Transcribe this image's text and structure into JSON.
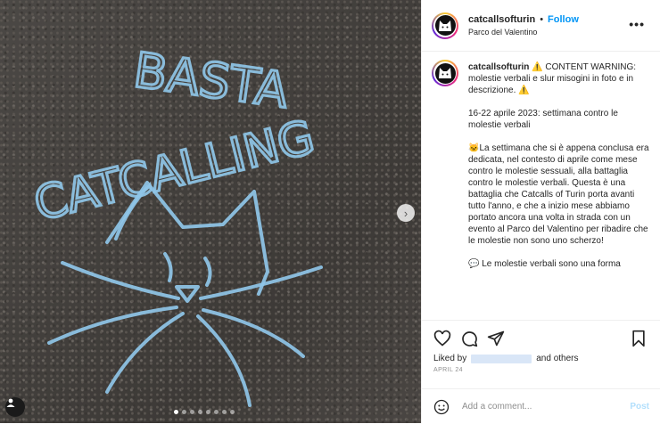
{
  "photo": {
    "chalk_line1": "BASTA",
    "chalk_line2": "CATCALLING",
    "carousel_dots": 8,
    "active_dot": 0
  },
  "header": {
    "username": "catcallsofturin",
    "separator": "•",
    "follow_label": "Follow",
    "location": "Parco del Valentino",
    "more_label": "•••"
  },
  "caption": {
    "username": "catcallsofturin",
    "paragraphs": [
      "⚠️ CONTENT WARNING: molestie verbali e slur misogini in foto e in descrizione. ⚠️",
      "16-22 aprile 2023: settimana contro le molestie verbali",
      "🐱La settimana che si è appena conclusa era dedicata, nel contesto di aprile come mese contro le molestie sessuali, alla battaglia contro le molestie verbali. Questa è una battaglia che Catcalls of Turin porta avanti tutto l'anno, e che a inizio mese abbiamo portato ancora una volta in strada con un evento al Parco del Valentino per ribadire che le molestie non sono uno scherzo!",
      "💬 Le molestie verbali sono una forma"
    ]
  },
  "actions": {
    "liked_by_prefix": "Liked by",
    "liked_by_suffix": "and others",
    "date": "APRIL 24"
  },
  "add_comment": {
    "placeholder": "Add a comment...",
    "post_label": "Post"
  },
  "colors": {
    "chalk": "#8fc6e8",
    "follow": "#0095f6",
    "post_disabled": "#b2dffc"
  }
}
